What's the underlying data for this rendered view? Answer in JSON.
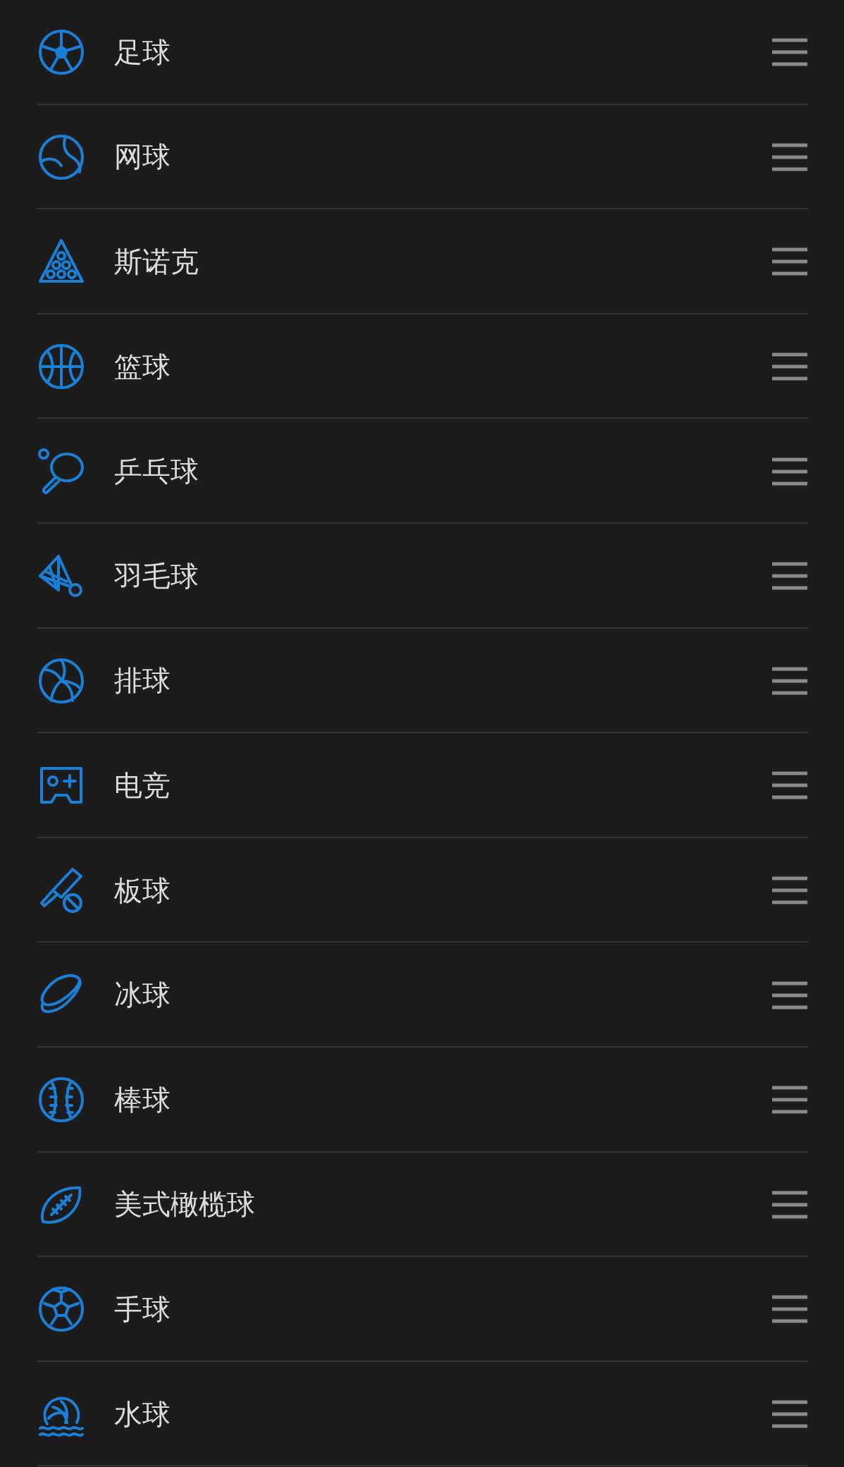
{
  "sports": [
    {
      "label": "足球"
    },
    {
      "label": "网球"
    },
    {
      "label": "斯诺克"
    },
    {
      "label": "篮球"
    },
    {
      "label": "乒乓球"
    },
    {
      "label": "羽毛球"
    },
    {
      "label": "排球"
    },
    {
      "label": "电竞"
    },
    {
      "label": "板球"
    },
    {
      "label": "冰球"
    },
    {
      "label": "棒球"
    },
    {
      "label": "美式橄榄球"
    },
    {
      "label": "手球"
    },
    {
      "label": "水球"
    }
  ]
}
